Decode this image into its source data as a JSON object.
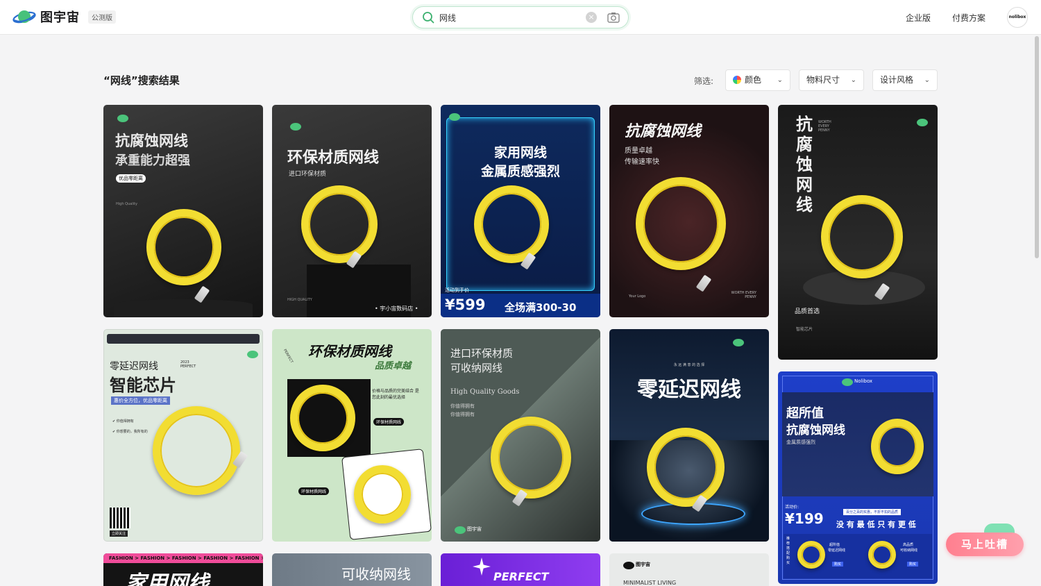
{
  "header": {
    "logo_text": "图宇宙",
    "beta_badge": "公测版",
    "search": {
      "value": "网线",
      "placeholder": ""
    },
    "nav": {
      "enterprise": "企业版",
      "pricing": "付费方案"
    },
    "avatar_text": "nolibox"
  },
  "results": {
    "title": "“网线”搜索结果"
  },
  "filters": {
    "label": "筛选:",
    "items": [
      {
        "label": "颜色",
        "icon": "color-wheel-icon"
      },
      {
        "label": "物料尺寸"
      },
      {
        "label": "设计风格"
      }
    ]
  },
  "cards": [
    {
      "title": "抗腐蚀网线",
      "sub": "承重能力超强",
      "tag": "优品零距离",
      "extra": "High Quality"
    },
    {
      "title": "环保材质网线",
      "sub": "进口环保材质",
      "footer": "• 宇小宙数码店 •",
      "extra": "HIGH QUALITY"
    },
    {
      "title": "家用网线",
      "sub": "金属质感强烈",
      "price_label": "活动到手价",
      "price": "¥599",
      "promo": "全场满300-30"
    },
    {
      "title": "抗腐蚀网线",
      "sub": "质量卓越",
      "sub2": "传输速率快",
      "footer": "WORTH EVERY PENNY",
      "logo": "Your Logo"
    },
    {
      "title": "抗腐蚀网线",
      "side": "WORTH EVERY PENNY",
      "sub": "品质首选",
      "sub2": "智能芯片"
    },
    {
      "title": "智能芯片",
      "pre": "零延迟网线",
      "year": "2023 PERFECT",
      "tag": "惠价全方位，优品零距离",
      "check1": "你值得拥有",
      "check2": "你想要的，我所有的",
      "qr_label": "立即关注"
    },
    {
      "title": "环保材质网线",
      "sub": "品质卓越",
      "desc": "价格与品质的完美结合 是您此刻的最优选择",
      "tag": "环保材质网线",
      "tag2": "环保材质网线",
      "side": "PERFECT"
    },
    {
      "title": "进口环保材质",
      "sub": "可收纳网线",
      "en": "High Quality Goods",
      "l1": "你值得拥有",
      "l2": "你值得拥有",
      "logo": "图宇宙"
    },
    {
      "pre": "永 远 满 意 的 选 择",
      "title": "零延迟网线"
    },
    {
      "logo": "Nolibox",
      "title": "超所值",
      "sub": "抗腐蚀网线",
      "sub2": "金属质感强烈",
      "price_label": "活动价:",
      "price": "¥199",
      "desc": "百分之百的实惠，不折不扣的品质",
      "slogan": "没 有 最 低 只 有 更 低",
      "side": "推荐搭配购买",
      "p1a": "超所值",
      "p1b": "零延迟网线",
      "buy": "购买",
      "p2a": "高品质",
      "p2b": "可收纳网线"
    },
    {
      "strip": "FASHION > FASHION > FASHION > FASHION > FASHION >",
      "title": "家用网线"
    },
    {
      "title": "可收纳网线"
    },
    {
      "title": "PERFECT"
    },
    {
      "logo": "图宇宙",
      "sub": "MINIMALIST LIVING"
    }
  ],
  "feedback": {
    "label": "马上吐槽"
  },
  "colors": {
    "accent": "#4bc47b",
    "cable": "#f2dd32",
    "feedback": "#ff8a99"
  }
}
